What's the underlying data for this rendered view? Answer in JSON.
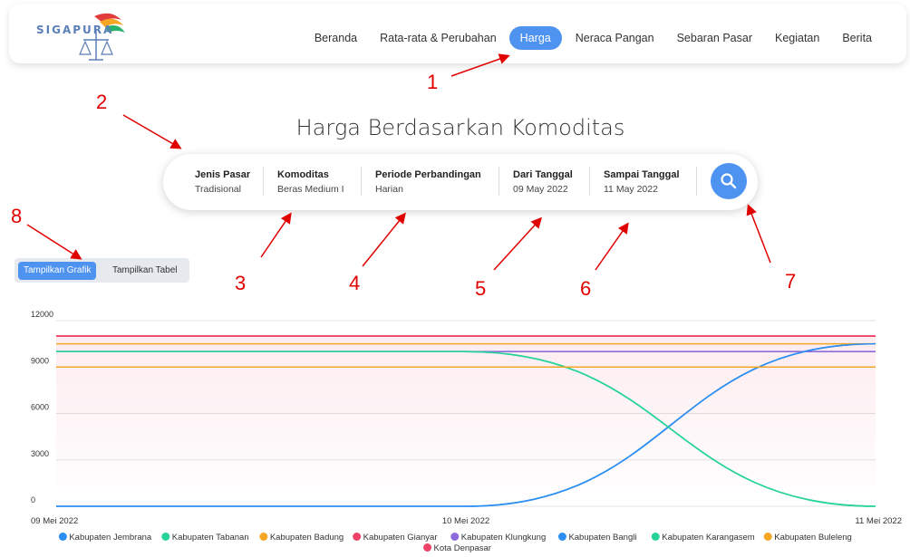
{
  "navbar": {
    "logo_text": "SIGAPURA",
    "links": [
      {
        "label": "Beranda",
        "active": false
      },
      {
        "label": "Rata-rata & Perubahan",
        "active": false
      },
      {
        "label": "Harga",
        "active": true
      },
      {
        "label": "Neraca Pangan",
        "active": false
      },
      {
        "label": "Sebaran Pasar",
        "active": false
      },
      {
        "label": "Kegiatan",
        "active": false
      },
      {
        "label": "Berita",
        "active": false
      }
    ]
  },
  "page_title": "Harga Berdasarkan Komoditas",
  "filters": {
    "jenis_pasar": {
      "label": "Jenis Pasar",
      "value": "Tradisional"
    },
    "komoditas": {
      "label": "Komoditas",
      "value": "Beras Medium I"
    },
    "periode": {
      "label": "Periode Perbandingan",
      "value": "Harian"
    },
    "dari": {
      "label": "Dari Tanggal",
      "value": "09 May 2022"
    },
    "sampai": {
      "label": "Sampai Tanggal",
      "value": "11 May 2022"
    },
    "search_icon": "search-icon"
  },
  "view_toggle": {
    "chart_label": "Tampilkan Grafik",
    "table_label": "Tampilkan Tabel",
    "active": "chart"
  },
  "annotations": [
    "1",
    "2",
    "3",
    "4",
    "5",
    "6",
    "7",
    "8"
  ],
  "colors": {
    "accent": "#4f93f0",
    "annotation": "#e00000"
  },
  "chart_data": {
    "type": "line",
    "x": [
      "09 Mei 2022",
      "10 Mei 2022",
      "11 Mei 2022"
    ],
    "ylim": [
      0,
      12000
    ],
    "yticks": [
      "0",
      "3000",
      "6000",
      "9000",
      "12000"
    ],
    "grid": true,
    "legend_position": "bottom",
    "series": [
      {
        "name": "Kabupaten Jembrana",
        "color": "#2b8ef0",
        "values": [
          0,
          0,
          10500
        ]
      },
      {
        "name": "Kabupaten Tabanan",
        "color": "#27d39b",
        "values": [
          10000,
          10000,
          0
        ]
      },
      {
        "name": "Kabupaten Badung",
        "color": "#f5a623",
        "values": [
          10500,
          10500,
          10500
        ]
      },
      {
        "name": "Kabupaten Gianyar",
        "color": "#ee4266",
        "values": [
          11000,
          11000,
          11000
        ]
      },
      {
        "name": "Kabupaten Klungkung",
        "color": "#8e6bdb",
        "values": [
          10000,
          10000,
          10000
        ]
      },
      {
        "name": "Kabupaten Bangli",
        "color": "#2b8ef0",
        "values": [
          0,
          0,
          10500
        ]
      },
      {
        "name": "Kabupaten Karangasem",
        "color": "#27d39b",
        "values": [
          10000,
          10000,
          0
        ]
      },
      {
        "name": "Kabupaten Buleleng",
        "color": "#f5a623",
        "values": [
          9000,
          9000,
          9000
        ]
      },
      {
        "name": "Kota Denpasar",
        "color": "#ee4266",
        "values": [
          11000,
          11000,
          11000
        ]
      }
    ]
  }
}
